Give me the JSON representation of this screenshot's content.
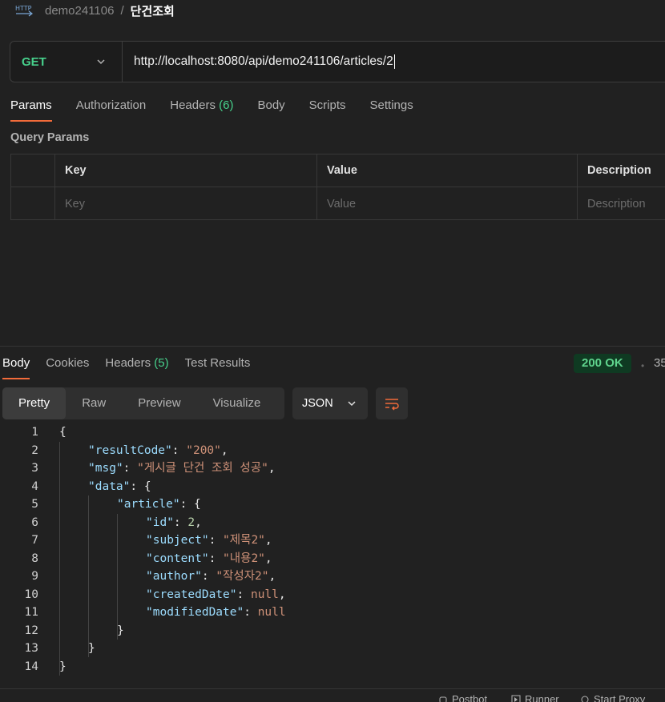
{
  "breadcrumb": {
    "collection": "demo241106",
    "separator": "/",
    "request": "단건조회"
  },
  "request": {
    "method": "GET",
    "url": "http://localhost:8080/api/demo241106/articles/2"
  },
  "request_tabs": [
    {
      "label": "Params",
      "count": ""
    },
    {
      "label": "Authorization",
      "count": ""
    },
    {
      "label": "Headers",
      "count": "(6)"
    },
    {
      "label": "Body",
      "count": ""
    },
    {
      "label": "Scripts",
      "count": ""
    },
    {
      "label": "Settings",
      "count": ""
    }
  ],
  "query_params": {
    "title": "Query Params",
    "headers": [
      "Key",
      "Value",
      "Description"
    ],
    "placeholders": [
      "Key",
      "Value",
      "Description"
    ]
  },
  "response_tabs": [
    {
      "label": "Body",
      "count": ""
    },
    {
      "label": "Cookies",
      "count": ""
    },
    {
      "label": "Headers",
      "count": "(5)"
    },
    {
      "label": "Test Results",
      "count": ""
    }
  ],
  "status": {
    "code": "200 OK",
    "time_partial": "35"
  },
  "view_modes": [
    "Pretty",
    "Raw",
    "Preview",
    "Visualize"
  ],
  "format": "JSON",
  "response_lines": [
    {
      "n": "1",
      "indent": 0,
      "parts": [
        [
          "p",
          "{"
        ]
      ]
    },
    {
      "n": "2",
      "indent": 1,
      "parts": [
        [
          "k",
          "\"resultCode\""
        ],
        [
          "p",
          ": "
        ],
        [
          "s",
          "\"200\""
        ],
        [
          "p",
          ","
        ]
      ]
    },
    {
      "n": "3",
      "indent": 1,
      "parts": [
        [
          "k",
          "\"msg\""
        ],
        [
          "p",
          ": "
        ],
        [
          "s",
          "\"게시글 단건 조회 성공\""
        ],
        [
          "p",
          ","
        ]
      ]
    },
    {
      "n": "4",
      "indent": 1,
      "parts": [
        [
          "k",
          "\"data\""
        ],
        [
          "p",
          ": {"
        ]
      ]
    },
    {
      "n": "5",
      "indent": 2,
      "parts": [
        [
          "k",
          "\"article\""
        ],
        [
          "p",
          ": {"
        ]
      ]
    },
    {
      "n": "6",
      "indent": 3,
      "parts": [
        [
          "k",
          "\"id\""
        ],
        [
          "p",
          ": "
        ],
        [
          "n",
          "2"
        ],
        [
          "p",
          ","
        ]
      ]
    },
    {
      "n": "7",
      "indent": 3,
      "parts": [
        [
          "k",
          "\"subject\""
        ],
        [
          "p",
          ": "
        ],
        [
          "s",
          "\"제목2\""
        ],
        [
          "p",
          ","
        ]
      ]
    },
    {
      "n": "8",
      "indent": 3,
      "parts": [
        [
          "k",
          "\"content\""
        ],
        [
          "p",
          ": "
        ],
        [
          "s",
          "\"내용2\""
        ],
        [
          "p",
          ","
        ]
      ]
    },
    {
      "n": "9",
      "indent": 3,
      "parts": [
        [
          "k",
          "\"author\""
        ],
        [
          "p",
          ": "
        ],
        [
          "s",
          "\"작성자2\""
        ],
        [
          "p",
          ","
        ]
      ]
    },
    {
      "n": "10",
      "indent": 3,
      "parts": [
        [
          "k",
          "\"createdDate\""
        ],
        [
          "p",
          ": "
        ],
        [
          "w",
          "null"
        ],
        [
          "p",
          ","
        ]
      ]
    },
    {
      "n": "11",
      "indent": 3,
      "parts": [
        [
          "k",
          "\"modifiedDate\""
        ],
        [
          "p",
          ": "
        ],
        [
          "w",
          "null"
        ]
      ]
    },
    {
      "n": "12",
      "indent": 2,
      "parts": [
        [
          "p",
          "}"
        ]
      ]
    },
    {
      "n": "13",
      "indent": 1,
      "parts": [
        [
          "p",
          "}"
        ]
      ]
    },
    {
      "n": "14",
      "indent": 0,
      "parts": [
        [
          "p",
          "}"
        ]
      ]
    }
  ],
  "footer": [
    "Postbot",
    "Runner",
    "Start Proxy"
  ],
  "colors": {
    "method_get": "#47d18c",
    "accent": "#f26b3a",
    "status_ok": "#5fd38d"
  }
}
